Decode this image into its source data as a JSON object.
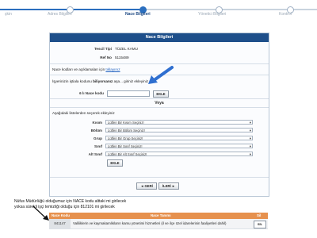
{
  "steps": [
    {
      "label": "şkin"
    },
    {
      "label": "Adres Bilgileri"
    },
    {
      "label": "Nace Bilgileri"
    },
    {
      "label": "Yönetici Bilgileri"
    },
    {
      "label": "Kontrol"
    }
  ],
  "panel": {
    "title": "Nace Bilgileri",
    "tescil_label": "Tescil Tipi",
    "tescil_value": "TÜZEL KAMU",
    "ref_label": "Ref No",
    "ref_value": "5115489",
    "info_text": "Nace kodları ve açıklamaları için",
    "info_link": "tıklayınız",
    "search_prefix": "İşyerinizin iştiala kodunu",
    "search_bold": "biliyorsanız",
    "search_suffix": "aşa... giriniz ekleyiniz",
    "nace_label": "6 lı Nace kodu",
    "nace_value": "",
    "ekle_label": "EKLE",
    "veya": "Veya",
    "list_instruction": "Aşağıdaki listelerden seçerek ekleyiniz",
    "dropdowns": [
      {
        "label": "Kısım",
        "value": "Lütfen Bir Kısım Seçiniz!"
      },
      {
        "label": "Bölüm",
        "value": "Lütfen Bir Bölüm Seçiniz!"
      },
      {
        "label": "Grup",
        "value": "Lütfen Bir Grup Seçiniz!"
      },
      {
        "label": "Sınıf",
        "value": "Lütfen Bir Sınıf Seçiniz!"
      },
      {
        "label": "Alt Sınıf",
        "value": "Lütfen Bir Alt Sınıf Seçiniz!"
      }
    ],
    "ekle2_label": "EKLE",
    "back_label": "◄ GERİ",
    "next_label": "İLERİ ►"
  },
  "note": {
    "line1": "Nüfus Müdürlüğü olduğumuz için NACE kodu alttaki mi girilecek",
    "line2": "yoksa sürekli işçi temizliği olduğu için 812101 mi girilecek"
  },
  "table": {
    "headers": [
      "Nace Kodu",
      "Nace Tanımı",
      "Sil"
    ],
    "rows": [
      {
        "code": "841147",
        "desc": "Valiliklerin ve kaymakamlıkların kamu yönetimi hizmetleri (il ve ilçe özel idarelerinin faaliyetleri dahil)",
        "action": "SİL"
      }
    ]
  },
  "colors": {
    "header_blue": "#1e4f8a",
    "table_header_orange": "#e6914e",
    "arrow_blue": "#2f6fd0"
  }
}
